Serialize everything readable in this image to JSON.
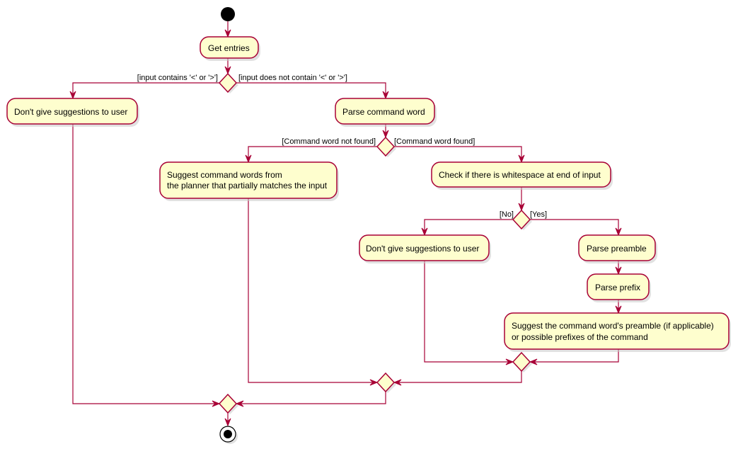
{
  "diagram": {
    "type": "activity",
    "colors": {
      "line": "#a80036",
      "fill": "#fefece",
      "node": "#000000"
    },
    "nodes": {
      "start": "start",
      "get_entries": [
        "Get entries"
      ],
      "no_suggest_left": [
        "Don't give suggestions to user"
      ],
      "parse_command_word": [
        "Parse command word"
      ],
      "suggest_command_words": [
        "Suggest command words from",
        "the planner that partially matches the input"
      ],
      "check_whitespace": [
        "Check if there is whitespace at end of input"
      ],
      "no_suggest_mid": [
        "Don't give suggestions to user"
      ],
      "parse_preamble": [
        "Parse preamble"
      ],
      "parse_prefix": [
        "Parse prefix"
      ],
      "suggest_preamble": [
        "Suggest the command word's preamble (if applicable)",
        "or possible prefixes of the command"
      ],
      "end": "end"
    },
    "guards": {
      "contains": "[input contains '<' or '>']",
      "not_contains": "[input does not contain '<' or '>']",
      "not_found": "[Command word not found]",
      "found": "[Command word found]",
      "no": "[No]",
      "yes": "[Yes]"
    }
  }
}
